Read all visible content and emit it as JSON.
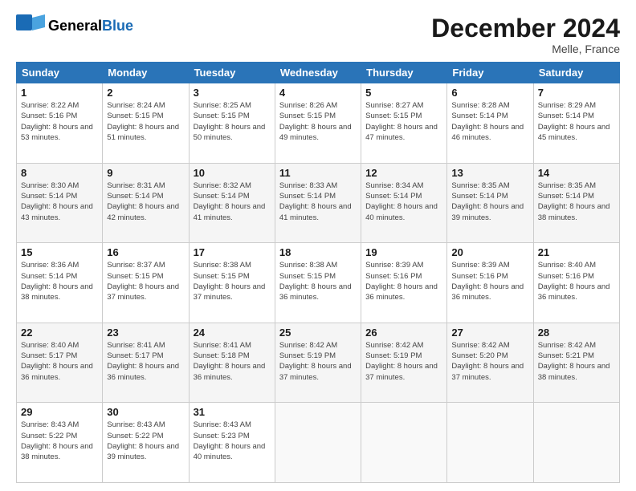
{
  "header": {
    "logo_general": "General",
    "logo_blue": "Blue",
    "month_title": "December 2024",
    "location": "Melle, France"
  },
  "days_of_week": [
    "Sunday",
    "Monday",
    "Tuesday",
    "Wednesday",
    "Thursday",
    "Friday",
    "Saturday"
  ],
  "weeks": [
    [
      {
        "day": "1",
        "sunrise": "Sunrise: 8:22 AM",
        "sunset": "Sunset: 5:16 PM",
        "daylight": "Daylight: 8 hours and 53 minutes."
      },
      {
        "day": "2",
        "sunrise": "Sunrise: 8:24 AM",
        "sunset": "Sunset: 5:15 PM",
        "daylight": "Daylight: 8 hours and 51 minutes."
      },
      {
        "day": "3",
        "sunrise": "Sunrise: 8:25 AM",
        "sunset": "Sunset: 5:15 PM",
        "daylight": "Daylight: 8 hours and 50 minutes."
      },
      {
        "day": "4",
        "sunrise": "Sunrise: 8:26 AM",
        "sunset": "Sunset: 5:15 PM",
        "daylight": "Daylight: 8 hours and 49 minutes."
      },
      {
        "day": "5",
        "sunrise": "Sunrise: 8:27 AM",
        "sunset": "Sunset: 5:15 PM",
        "daylight": "Daylight: 8 hours and 47 minutes."
      },
      {
        "day": "6",
        "sunrise": "Sunrise: 8:28 AM",
        "sunset": "Sunset: 5:14 PM",
        "daylight": "Daylight: 8 hours and 46 minutes."
      },
      {
        "day": "7",
        "sunrise": "Sunrise: 8:29 AM",
        "sunset": "Sunset: 5:14 PM",
        "daylight": "Daylight: 8 hours and 45 minutes."
      }
    ],
    [
      {
        "day": "8",
        "sunrise": "Sunrise: 8:30 AM",
        "sunset": "Sunset: 5:14 PM",
        "daylight": "Daylight: 8 hours and 43 minutes."
      },
      {
        "day": "9",
        "sunrise": "Sunrise: 8:31 AM",
        "sunset": "Sunset: 5:14 PM",
        "daylight": "Daylight: 8 hours and 42 minutes."
      },
      {
        "day": "10",
        "sunrise": "Sunrise: 8:32 AM",
        "sunset": "Sunset: 5:14 PM",
        "daylight": "Daylight: 8 hours and 41 minutes."
      },
      {
        "day": "11",
        "sunrise": "Sunrise: 8:33 AM",
        "sunset": "Sunset: 5:14 PM",
        "daylight": "Daylight: 8 hours and 41 minutes."
      },
      {
        "day": "12",
        "sunrise": "Sunrise: 8:34 AM",
        "sunset": "Sunset: 5:14 PM",
        "daylight": "Daylight: 8 hours and 40 minutes."
      },
      {
        "day": "13",
        "sunrise": "Sunrise: 8:35 AM",
        "sunset": "Sunset: 5:14 PM",
        "daylight": "Daylight: 8 hours and 39 minutes."
      },
      {
        "day": "14",
        "sunrise": "Sunrise: 8:35 AM",
        "sunset": "Sunset: 5:14 PM",
        "daylight": "Daylight: 8 hours and 38 minutes."
      }
    ],
    [
      {
        "day": "15",
        "sunrise": "Sunrise: 8:36 AM",
        "sunset": "Sunset: 5:14 PM",
        "daylight": "Daylight: 8 hours and 38 minutes."
      },
      {
        "day": "16",
        "sunrise": "Sunrise: 8:37 AM",
        "sunset": "Sunset: 5:15 PM",
        "daylight": "Daylight: 8 hours and 37 minutes."
      },
      {
        "day": "17",
        "sunrise": "Sunrise: 8:38 AM",
        "sunset": "Sunset: 5:15 PM",
        "daylight": "Daylight: 8 hours and 37 minutes."
      },
      {
        "day": "18",
        "sunrise": "Sunrise: 8:38 AM",
        "sunset": "Sunset: 5:15 PM",
        "daylight": "Daylight: 8 hours and 36 minutes."
      },
      {
        "day": "19",
        "sunrise": "Sunrise: 8:39 AM",
        "sunset": "Sunset: 5:16 PM",
        "daylight": "Daylight: 8 hours and 36 minutes."
      },
      {
        "day": "20",
        "sunrise": "Sunrise: 8:39 AM",
        "sunset": "Sunset: 5:16 PM",
        "daylight": "Daylight: 8 hours and 36 minutes."
      },
      {
        "day": "21",
        "sunrise": "Sunrise: 8:40 AM",
        "sunset": "Sunset: 5:16 PM",
        "daylight": "Daylight: 8 hours and 36 minutes."
      }
    ],
    [
      {
        "day": "22",
        "sunrise": "Sunrise: 8:40 AM",
        "sunset": "Sunset: 5:17 PM",
        "daylight": "Daylight: 8 hours and 36 minutes."
      },
      {
        "day": "23",
        "sunrise": "Sunrise: 8:41 AM",
        "sunset": "Sunset: 5:17 PM",
        "daylight": "Daylight: 8 hours and 36 minutes."
      },
      {
        "day": "24",
        "sunrise": "Sunrise: 8:41 AM",
        "sunset": "Sunset: 5:18 PM",
        "daylight": "Daylight: 8 hours and 36 minutes."
      },
      {
        "day": "25",
        "sunrise": "Sunrise: 8:42 AM",
        "sunset": "Sunset: 5:19 PM",
        "daylight": "Daylight: 8 hours and 37 minutes."
      },
      {
        "day": "26",
        "sunrise": "Sunrise: 8:42 AM",
        "sunset": "Sunset: 5:19 PM",
        "daylight": "Daylight: 8 hours and 37 minutes."
      },
      {
        "day": "27",
        "sunrise": "Sunrise: 8:42 AM",
        "sunset": "Sunset: 5:20 PM",
        "daylight": "Daylight: 8 hours and 37 minutes."
      },
      {
        "day": "28",
        "sunrise": "Sunrise: 8:42 AM",
        "sunset": "Sunset: 5:21 PM",
        "daylight": "Daylight: 8 hours and 38 minutes."
      }
    ],
    [
      {
        "day": "29",
        "sunrise": "Sunrise: 8:43 AM",
        "sunset": "Sunset: 5:22 PM",
        "daylight": "Daylight: 8 hours and 38 minutes."
      },
      {
        "day": "30",
        "sunrise": "Sunrise: 8:43 AM",
        "sunset": "Sunset: 5:22 PM",
        "daylight": "Daylight: 8 hours and 39 minutes."
      },
      {
        "day": "31",
        "sunrise": "Sunrise: 8:43 AM",
        "sunset": "Sunset: 5:23 PM",
        "daylight": "Daylight: 8 hours and 40 minutes."
      },
      null,
      null,
      null,
      null
    ]
  ]
}
